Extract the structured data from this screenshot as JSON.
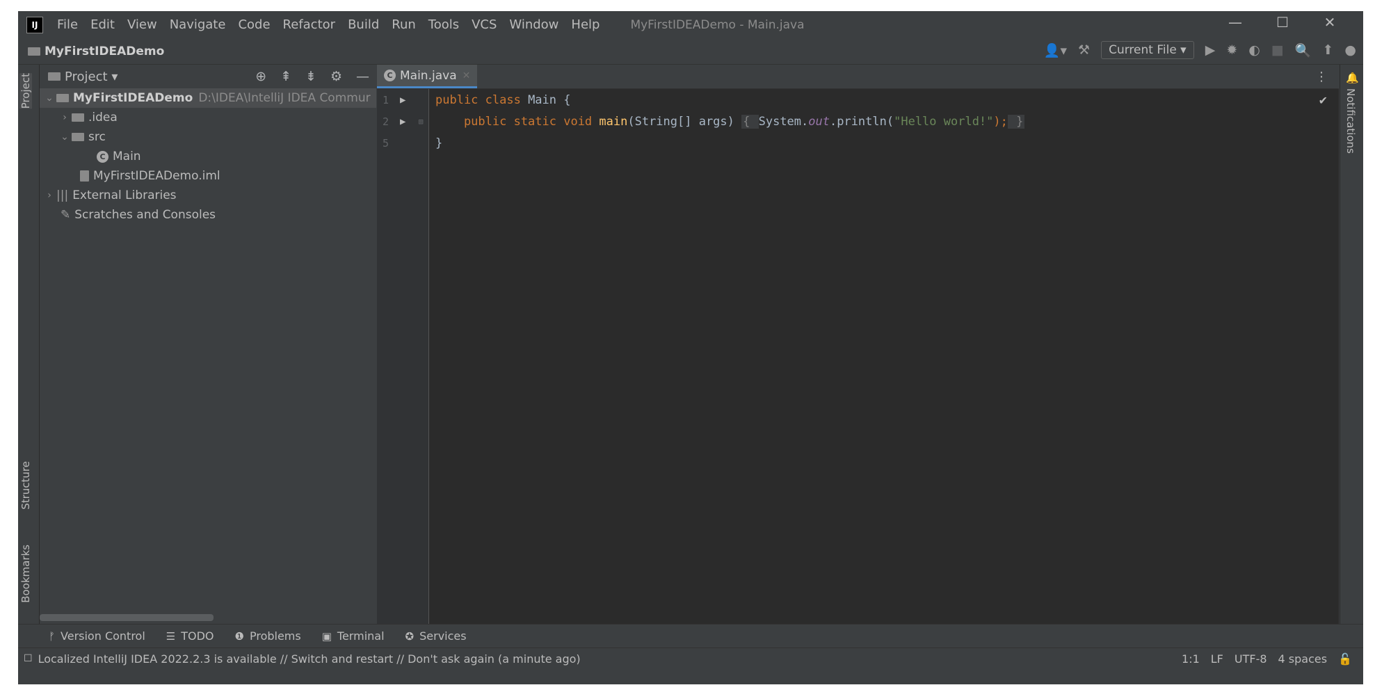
{
  "menubar": {
    "logo": "IJ",
    "items": [
      "File",
      "Edit",
      "View",
      "Navigate",
      "Code",
      "Refactor",
      "Build",
      "Run",
      "Tools",
      "VCS",
      "Window",
      "Help"
    ],
    "window_title": "MyFirstIDEADemo - Main.java",
    "window_buttons": {
      "minimize": "—",
      "maximize": "☐",
      "close": "✕"
    }
  },
  "navbar": {
    "project": "MyFirstIDEADemo",
    "run_config": "Current File"
  },
  "left_strip": {
    "project": "Project",
    "structure": "Structure",
    "bookmarks": "Bookmarks"
  },
  "right_strip": {
    "notifications": "Notifications"
  },
  "project_panel": {
    "header": "Project",
    "tree": [
      {
        "label": "MyFirstIDEADemo",
        "path": "D:\\IDEA\\IntelliJ IDEA Commur",
        "expanded": true
      },
      {
        "label": ".idea",
        "expanded": false
      },
      {
        "label": "src",
        "expanded": true
      },
      {
        "label": "Main"
      },
      {
        "label": "MyFirstIDEADemo.iml"
      },
      {
        "label": "External Libraries",
        "expanded": false
      },
      {
        "label": "Scratches and Consoles"
      }
    ]
  },
  "editor": {
    "tab": "Main.java",
    "line_numbers": [
      "1",
      "2",
      "5"
    ],
    "code": {
      "l1_kw": "public class ",
      "l1_name": "Main {",
      "l2_kw": "    public static void ",
      "l2_fn": "main",
      "l2_args": "(String[] args) ",
      "l2_open": "{ ",
      "l2_sys": "System.",
      "l2_out": "out",
      "l2_call": ".println(",
      "l2_str": "\"Hello world!\"",
      "l2_end": ");",
      "l2_close": " }",
      "l3": "}"
    }
  },
  "bottom_tools": [
    "Version Control",
    "TODO",
    "Problems",
    "Terminal",
    "Services"
  ],
  "statusbar": {
    "message": "Localized IntelliJ IDEA 2022.2.3 is available // Switch and restart // Don't ask again (a minute ago)",
    "position": "1:1",
    "line_sep": "LF",
    "encoding": "UTF-8",
    "indent": "4 spaces"
  }
}
